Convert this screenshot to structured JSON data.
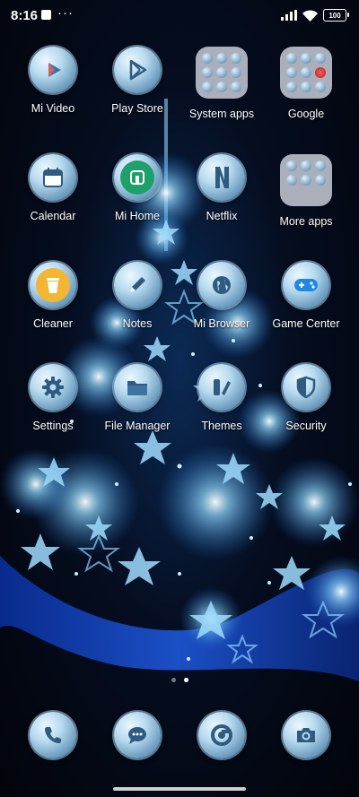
{
  "status_bar": {
    "time": "8:16",
    "more_indicator": "···",
    "battery": "100",
    "icons": [
      "notification-square-icon",
      "signal-icon",
      "wifi-icon",
      "battery-icon"
    ]
  },
  "apps": [
    {
      "label": "Mi Video",
      "icon": "mi-video-icon"
    },
    {
      "label": "Play Store",
      "icon": "play-store-icon"
    },
    {
      "label": "System apps",
      "icon": "folder-icon"
    },
    {
      "label": "Google",
      "icon": "folder-icon"
    },
    {
      "label": "Calendar",
      "icon": "calendar-icon"
    },
    {
      "label": "Mi Home",
      "icon": "mi-home-icon"
    },
    {
      "label": "Netflix",
      "icon": "netflix-icon"
    },
    {
      "label": "More apps",
      "icon": "folder-icon"
    },
    {
      "label": "Cleaner",
      "icon": "cleaner-icon"
    },
    {
      "label": "Notes",
      "icon": "notes-icon"
    },
    {
      "label": "Mi Browser",
      "icon": "browser-icon"
    },
    {
      "label": "Game Center",
      "icon": "game-center-icon"
    },
    {
      "label": "Settings",
      "icon": "gear-icon"
    },
    {
      "label": "File Manager",
      "icon": "file-manager-icon"
    },
    {
      "label": "Themes",
      "icon": "themes-icon"
    },
    {
      "label": "Security",
      "icon": "security-shield-icon"
    }
  ],
  "page_indicator": {
    "pages": 2,
    "current": 2
  },
  "dock": [
    {
      "icon": "phone-icon"
    },
    {
      "icon": "messages-icon"
    },
    {
      "icon": "chrome-icon"
    },
    {
      "icon": "camera-icon"
    }
  ],
  "colors": {
    "icon_fill": "#b9dbef",
    "icon_glyph": "#2f5b80",
    "wallpaper_star": "#7fd0ff"
  }
}
